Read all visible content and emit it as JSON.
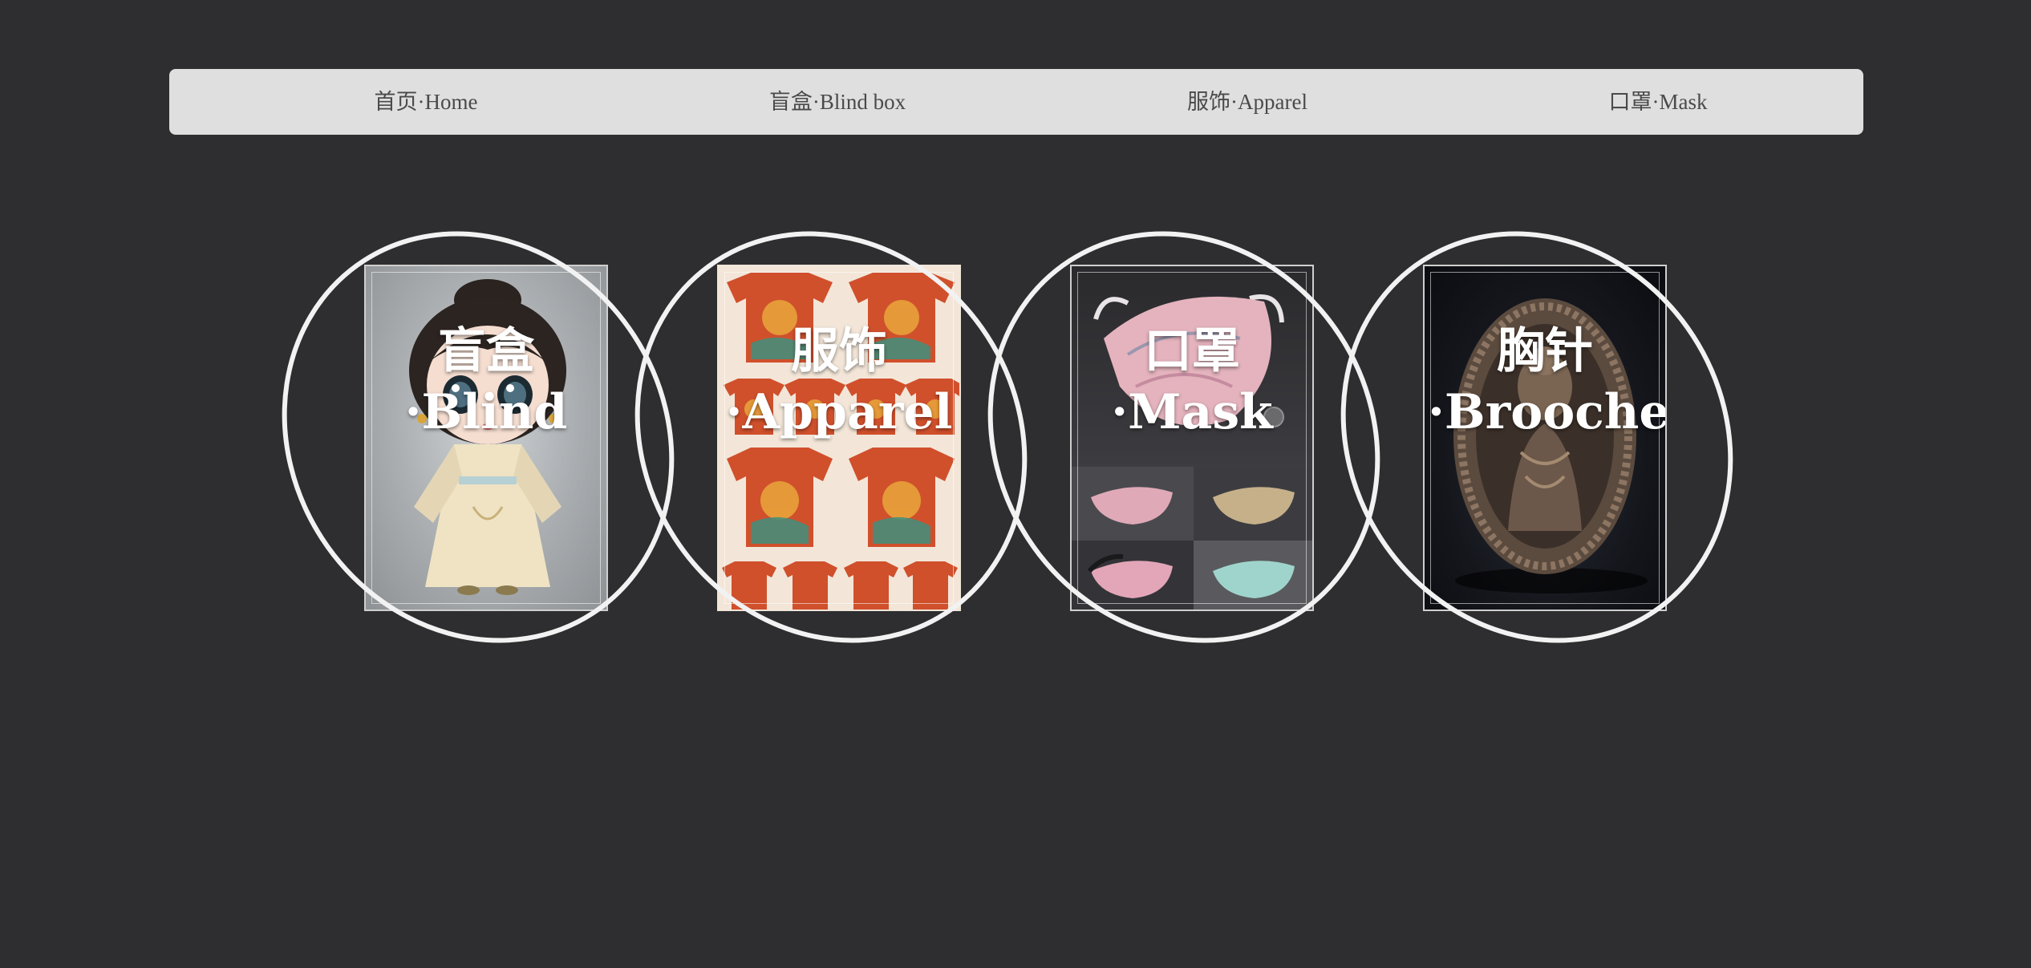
{
  "nav": {
    "items": [
      {
        "label": "首页·Home"
      },
      {
        "label": "盲盒·Blind box"
      },
      {
        "label": "服饰·Apparel"
      },
      {
        "label": "口罩·Mask"
      }
    ]
  },
  "cards": [
    {
      "title": "盲盒·Blind",
      "image": "doll-figure-image"
    },
    {
      "title": "服饰·Apparel",
      "image": "dragon-tshirts-image"
    },
    {
      "title": "口罩·Mask",
      "image": "patterned-masks-image"
    },
    {
      "title": "胸针·Brooches",
      "image": "carved-brooch-image"
    }
  ],
  "colors": {
    "background": "#2e2e30",
    "navbar": "#dfdfdf",
    "nav_text": "#4a4a4a",
    "ring": "#f2f2f2",
    "card_title": "#ffffff"
  }
}
